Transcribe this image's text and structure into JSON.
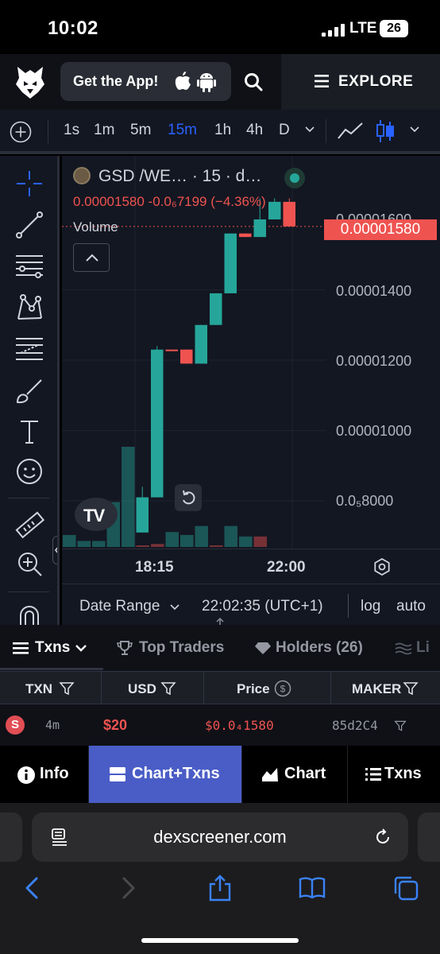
{
  "status_bar": {
    "time": "10:02",
    "network": "LTE",
    "battery": "26"
  },
  "app_header": {
    "get_app_label": "Get the App!",
    "explore_label": "EXPLORE"
  },
  "chart_toolbar": {
    "timeframes": [
      "1s",
      "1m",
      "5m",
      "15m",
      "1h",
      "4h",
      "D"
    ],
    "active_timeframe": "15m"
  },
  "chart_header": {
    "title": "GSD /WE… · 15 · d…",
    "ohlc_text": "0.00001580  -0.0₆7199 (−4.36%)",
    "volume_label": "Volume"
  },
  "chart_data": {
    "type": "candlestick",
    "x_tick_labels": [
      "18:15",
      "22:00"
    ],
    "y_tick_labels": [
      "0.0₅8000",
      "0.00001000",
      "0.00001200",
      "0.00001400",
      "0.00001600"
    ],
    "ylim": [
      7e-06,
      1.66e-05
    ],
    "current_price": 1.58e-05,
    "current_price_label": "0.00001580",
    "candles": [
      {
        "o": 7.1e-06,
        "h": 8.4e-06,
        "l": 7.1e-06,
        "c": 8.1e-06,
        "dir": "up"
      },
      {
        "o": 8.1e-06,
        "h": 1.24e-05,
        "l": 8.1e-06,
        "c": 1.23e-05,
        "dir": "up"
      },
      {
        "o": 1.23e-05,
        "h": 1.23e-05,
        "l": 1.23e-05,
        "c": 1.23e-05,
        "dir": "down"
      },
      {
        "o": 1.23e-05,
        "h": 1.23e-05,
        "l": 1.19e-05,
        "c": 1.19e-05,
        "dir": "down"
      },
      {
        "o": 1.19e-05,
        "h": 1.3e-05,
        "l": 1.19e-05,
        "c": 1.3e-05,
        "dir": "up"
      },
      {
        "o": 1.3e-05,
        "h": 1.39e-05,
        "l": 1.3e-05,
        "c": 1.39e-05,
        "dir": "up"
      },
      {
        "o": 1.39e-05,
        "h": 1.56e-05,
        "l": 1.39e-05,
        "c": 1.56e-05,
        "dir": "up"
      },
      {
        "o": 1.56e-05,
        "h": 1.56e-05,
        "l": 1.55e-05,
        "c": 1.55e-05,
        "dir": "down"
      },
      {
        "o": 1.55e-05,
        "h": 1.66e-05,
        "l": 1.55e-05,
        "c": 1.6e-05,
        "dir": "up"
      },
      {
        "o": 1.6e-05,
        "h": 1.66e-05,
        "l": 1.6e-05,
        "c": 1.65e-05,
        "dir": "up"
      },
      {
        "o": 1.65e-05,
        "h": 1.66e-05,
        "l": 1.58e-05,
        "c": 1.58e-05,
        "dir": "down"
      }
    ],
    "volume": [
      {
        "v": 8,
        "dir": "up"
      },
      {
        "v": 4,
        "dir": "up"
      },
      {
        "v": 4,
        "dir": "up"
      },
      {
        "v": 30,
        "dir": "up"
      },
      {
        "v": 67,
        "dir": "up"
      },
      {
        "v": 1,
        "dir": "down"
      },
      {
        "v": 2,
        "dir": "down"
      },
      {
        "v": 10,
        "dir": "up"
      },
      {
        "v": 8,
        "dir": "up"
      },
      {
        "v": 14,
        "dir": "up"
      },
      {
        "v": 1,
        "dir": "down"
      },
      {
        "v": 14,
        "dir": "up"
      },
      {
        "v": 7,
        "dir": "up"
      },
      {
        "v": 7,
        "dir": "down"
      }
    ]
  },
  "chart_footer": {
    "date_range_label": "Date Range",
    "clock": "22:02:35 (UTC+1)",
    "log_label": "log",
    "auto_label": "auto"
  },
  "tabs": {
    "txns": "Txns",
    "top_traders": "Top Traders",
    "holders": "Holders (26)",
    "liquidity": "Li"
  },
  "table": {
    "headers": [
      "TXN",
      "USD",
      "Price",
      "MAKER"
    ],
    "row": {
      "type": "S",
      "age": "4m",
      "usd": "$20",
      "price": "$0.0₄1580",
      "maker": "85d2C4"
    }
  },
  "view_modes": {
    "info": "Info",
    "chart_txns": "Chart+Txns",
    "chart": "Chart",
    "txns": "Txns",
    "active": "Chart+Txns"
  },
  "browser": {
    "url": "dexscreener.com"
  },
  "colors": {
    "up": "#26a69a",
    "down": "#ef5350",
    "accent": "#2962ff",
    "active_view": "#4a5dc6"
  }
}
